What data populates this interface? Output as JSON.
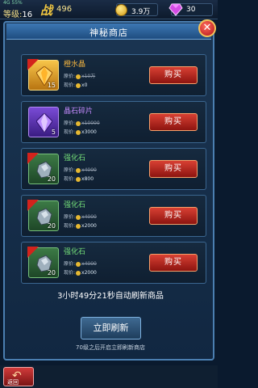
{
  "status": {
    "tiny_text": "4G 55%",
    "level_label": "等级:",
    "level_value": "16",
    "power_icon": "战",
    "power_value": "496",
    "coins": "3.9万",
    "gems": "30"
  },
  "shop": {
    "title": "神秘商店",
    "items": [
      {
        "name": "橙水晶",
        "qty": "15",
        "orig_label": "原价:",
        "orig_value": "x10万",
        "cur_label": "现价:",
        "cur_value": "x0",
        "buy": "购买"
      },
      {
        "name": "晶石碎片",
        "qty": "5",
        "orig_label": "原价:",
        "orig_value": "x10000",
        "cur_label": "现价:",
        "cur_value": "x3000",
        "buy": "购买"
      },
      {
        "name": "强化石",
        "qty": "20",
        "orig_label": "原价:",
        "orig_value": "x4000",
        "cur_label": "现价:",
        "cur_value": "x800",
        "buy": "购买"
      },
      {
        "name": "强化石",
        "qty": "20",
        "orig_label": "原价:",
        "orig_value": "x4000",
        "cur_label": "现价:",
        "cur_value": "x2000",
        "buy": "购买"
      },
      {
        "name": "强化石",
        "qty": "20",
        "orig_label": "原价:",
        "orig_value": "x4000",
        "cur_label": "现价:",
        "cur_value": "x2000",
        "buy": "购买"
      }
    ],
    "countdown": "3小时49分21秒自动刷新商品",
    "refresh": "立即刷新",
    "hint": "70级之后开启立即刷新商店"
  },
  "nav": {
    "back_label": "返回"
  },
  "colors": {
    "buy_red": "#d84033",
    "panel_blue": "#1b3552"
  }
}
